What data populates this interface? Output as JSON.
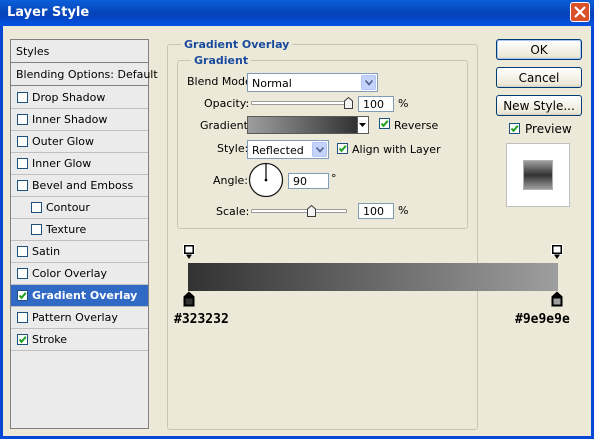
{
  "window": {
    "title": "Layer Style"
  },
  "sidebar": {
    "header": "Styles",
    "blending": "Blending Options: Default",
    "items": [
      {
        "label": "Drop Shadow",
        "checked": false
      },
      {
        "label": "Inner Shadow",
        "checked": false
      },
      {
        "label": "Outer Glow",
        "checked": false
      },
      {
        "label": "Inner Glow",
        "checked": false
      },
      {
        "label": "Bevel and Emboss",
        "checked": false
      },
      {
        "label": "Contour",
        "checked": false
      },
      {
        "label": "Texture",
        "checked": false
      },
      {
        "label": "Satin",
        "checked": false
      },
      {
        "label": "Color Overlay",
        "checked": false
      },
      {
        "label": "Gradient Overlay",
        "checked": true,
        "selected": true
      },
      {
        "label": "Pattern Overlay",
        "checked": false
      },
      {
        "label": "Stroke",
        "checked": true
      }
    ]
  },
  "panel": {
    "title": "Gradient Overlay",
    "group_title": "Gradient",
    "blend_mode": {
      "label": "Blend Mode:",
      "value": "Normal"
    },
    "opacity": {
      "label": "Opacity:",
      "value": "100",
      "unit": "%",
      "level": 100
    },
    "gradient": {
      "label": "Gradient:",
      "reverse_label": "Reverse",
      "reverse_checked": true,
      "start_color": "#323232",
      "end_color": "#9e9e9e"
    },
    "style": {
      "label": "Style:",
      "value": "Reflected",
      "align_label": "Align with Layer",
      "align_checked": true
    },
    "angle": {
      "label": "Angle:",
      "value": "90",
      "unit": "°"
    },
    "scale": {
      "label": "Scale:",
      "value": "100",
      "unit": "%",
      "level": 100
    }
  },
  "gradient_editor": {
    "start_label": "#323232",
    "end_label": "#9e9e9e",
    "start_color": "#323232",
    "end_color": "#9e9e9e"
  },
  "buttons": {
    "ok": "OK",
    "cancel": "Cancel",
    "new_style": "New Style...",
    "preview_label": "Preview",
    "preview_checked": true
  },
  "colors": {
    "title_blue": "#0548d6",
    "selection": "#316ac5",
    "accent_text": "#1a4b9c"
  }
}
